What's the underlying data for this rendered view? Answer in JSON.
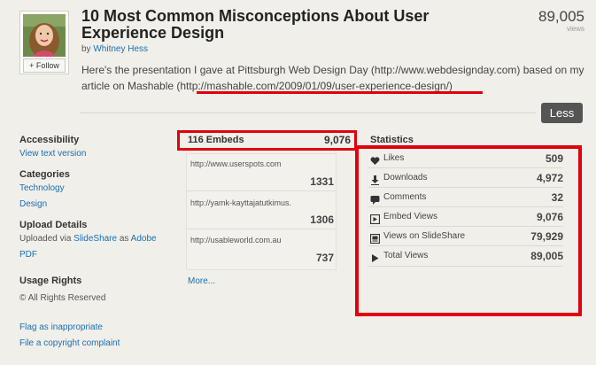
{
  "header": {
    "title": "10 Most Common Misconceptions About User Experience Design",
    "author_prefix": "by",
    "author": "Whitney Hess",
    "follow_label": "+ Follow",
    "views_count": "89,005",
    "views_label": "views",
    "description": "Here's the presentation I gave at Pittsburgh Web Design Day (http://www.webdesignday.com) based on my article on Mashable (http://mashable.com/2009/01/09/user-experience-design/)",
    "less_label": "Less"
  },
  "sidebar": {
    "accessibility_heading": "Accessibility",
    "text_version_link": "View text version",
    "categories_heading": "Categories",
    "category_technology": "Technology",
    "category_design": "Design",
    "upload_heading": "Upload Details",
    "uploaded_via_prefix": "Uploaded via",
    "uploaded_via_link": "SlideShare",
    "uploaded_as": "as",
    "uploaded_format_1": "Adobe",
    "uploaded_format_2": "PDF",
    "usage_heading": "Usage Rights",
    "usage_text": "© All Rights Reserved",
    "flag_link": "Flag as inappropriate",
    "copyright_link": "File a copyright complaint"
  },
  "embeds": {
    "heading": "116 Embeds",
    "total": "9,076",
    "items": [
      {
        "url": "http://www.userspots.com",
        "count": "1331"
      },
      {
        "url": "http://yamk-kayttajatutkimus.",
        "count": "1306"
      },
      {
        "url": "http://usableworld.com.au",
        "count": "737"
      }
    ],
    "more_link": "More..."
  },
  "statistics": {
    "heading": "Statistics",
    "rows": [
      {
        "label": "Likes",
        "value": "509",
        "icon": "heart-icon"
      },
      {
        "label": "Downloads",
        "value": "4,972",
        "icon": "download-icon"
      },
      {
        "label": "Comments",
        "value": "32",
        "icon": "comment-icon"
      },
      {
        "label": "Embed Views",
        "value": "9,076",
        "icon": "embed-icon"
      },
      {
        "label": "Views on SlideShare",
        "value": "79,929",
        "icon": "slideshare-icon"
      },
      {
        "label": "Total Views",
        "value": "89,005",
        "icon": "play-icon"
      }
    ]
  },
  "colors": {
    "link": "#1a6fb3",
    "highlight": "#e0000e",
    "background": "#f0efe9"
  }
}
